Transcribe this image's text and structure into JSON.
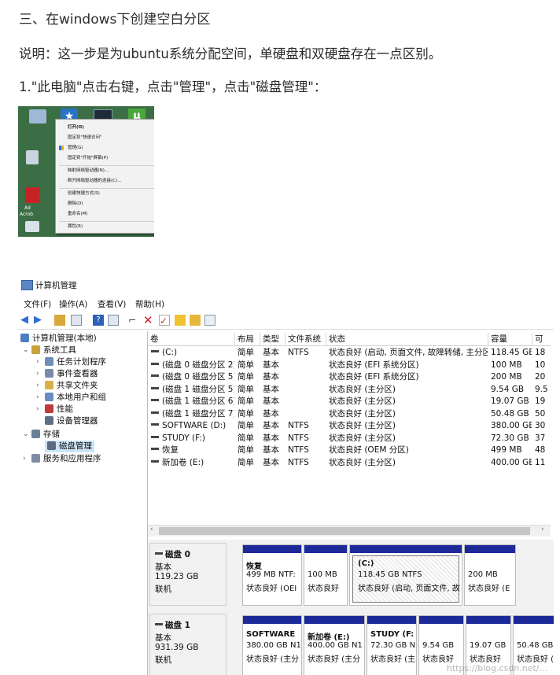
{
  "heading": "三、在windows下创建空白分区",
  "intro": "说明：这一步是为ubuntu系统分配空间，单硬盘和双硬盘存在一点区别。",
  "step1": "1.\"此电脑\"点击右键，点击\"管理\"，点击\"磁盘管理\"：",
  "context_menu": {
    "desktop_labels": [
      "Ad",
      "Acrob"
    ],
    "items": [
      {
        "label": "打开(O)",
        "bold": true
      },
      {
        "label": "固定到\"快速访问\""
      },
      {
        "label": "管理(G)"
      },
      {
        "label": "固定到\"开始\"屏幕(P)"
      },
      {
        "label": "映射网络驱动器(N)..."
      },
      {
        "label": "断开网络驱动器的连接(C)..."
      },
      {
        "label": "创建快捷方式(S)"
      },
      {
        "label": "删除(D)"
      },
      {
        "label": "重命名(M)"
      },
      {
        "label": "属性(R)"
      }
    ]
  },
  "window": {
    "title": "计算机管理",
    "menu": [
      "文件(F)",
      "操作(A)",
      "查看(V)",
      "帮助(H)"
    ],
    "tree": [
      {
        "label": "计算机管理(本地)",
        "icon": "computer-management-icon",
        "color": "#4a7fc0"
      },
      {
        "label": "系统工具",
        "icon": "tools-icon",
        "color": "#c9a23c"
      },
      {
        "label": "任务计划程序",
        "icon": "clock-icon",
        "color": "#6d8fb3"
      },
      {
        "label": "事件查看器",
        "icon": "event-viewer-icon",
        "color": "#7a8aa8"
      },
      {
        "label": "共享文件夹",
        "icon": "shared-folder-icon",
        "color": "#d8b048"
      },
      {
        "label": "本地用户和组",
        "icon": "users-icon",
        "color": "#6a8cc4"
      },
      {
        "label": "性能",
        "icon": "performance-icon",
        "color": "#c03a3a"
      },
      {
        "label": "设备管理器",
        "icon": "device-manager-icon",
        "color": "#5c6f86"
      },
      {
        "label": "存储",
        "icon": "storage-icon",
        "color": "#6a7f98"
      },
      {
        "label": "磁盘管理",
        "icon": "disk-management-icon",
        "color": "#5a6b80"
      },
      {
        "label": "服务和应用程序",
        "icon": "services-icon",
        "color": "#7c8ca4"
      }
    ],
    "columns": [
      "卷",
      "布局",
      "类型",
      "文件系统",
      "状态",
      "容量",
      "可"
    ],
    "volumes": [
      {
        "name": "(C:)",
        "layout": "简单",
        "type": "基本",
        "fs": "NTFS",
        "status": "状态良好 (启动, 页面文件, 故障转储, 主分区)",
        "capacity": "118.45 GB",
        "free": "18"
      },
      {
        "name": "(磁盘 0 磁盘分区 2)",
        "layout": "简单",
        "type": "基本",
        "fs": "",
        "status": "状态良好 (EFI 系统分区)",
        "capacity": "100 MB",
        "free": "10"
      },
      {
        "name": "(磁盘 0 磁盘分区 5)",
        "layout": "简单",
        "type": "基本",
        "fs": "",
        "status": "状态良好 (EFI 系统分区)",
        "capacity": "200 MB",
        "free": "20"
      },
      {
        "name": "(磁盘 1 磁盘分区 5)",
        "layout": "简单",
        "type": "基本",
        "fs": "",
        "status": "状态良好 (主分区)",
        "capacity": "9.54 GB",
        "free": "9.5"
      },
      {
        "name": "(磁盘 1 磁盘分区 6)",
        "layout": "简单",
        "type": "基本",
        "fs": "",
        "status": "状态良好 (主分区)",
        "capacity": "19.07 GB",
        "free": "19"
      },
      {
        "name": "(磁盘 1 磁盘分区 7)",
        "layout": "简单",
        "type": "基本",
        "fs": "",
        "status": "状态良好 (主分区)",
        "capacity": "50.48 GB",
        "free": "50"
      },
      {
        "name": "SOFTWARE (D:)",
        "layout": "简单",
        "type": "基本",
        "fs": "NTFS",
        "status": "状态良好 (主分区)",
        "capacity": "380.00 GB",
        "free": "30"
      },
      {
        "name": "STUDY (F:)",
        "layout": "简单",
        "type": "基本",
        "fs": "NTFS",
        "status": "状态良好 (主分区)",
        "capacity": "72.30 GB",
        "free": "37"
      },
      {
        "name": "恢复",
        "layout": "简单",
        "type": "基本",
        "fs": "NTFS",
        "status": "状态良好 (OEM 分区)",
        "capacity": "499 MB",
        "free": "48"
      },
      {
        "name": "新加卷 (E:)",
        "layout": "简单",
        "type": "基本",
        "fs": "NTFS",
        "status": "状态良好 (主分区)",
        "capacity": "400.00 GB",
        "free": "11"
      }
    ],
    "disks": [
      {
        "name": "磁盘 0",
        "kind": "基本",
        "size": "119.23 GB",
        "state": "联机",
        "partitions": [
          {
            "l1": "恢复",
            "l2": "499 MB NTF:",
            "l3": "状态良好 (OEI",
            "selected": false
          },
          {
            "l1": "",
            "l2": "100 MB",
            "l3": "状态良好",
            "selected": false
          },
          {
            "l1": "(C:)",
            "l2": "118.45 GB NTFS",
            "l3": "状态良好 (启动, 页面文件, 故",
            "selected": true
          },
          {
            "l1": "",
            "l2": "200 MB",
            "l3": "状态良好 (E",
            "selected": false
          }
        ]
      },
      {
        "name": "磁盘 1",
        "kind": "基本",
        "size": "931.39 GB",
        "state": "联机",
        "partitions": [
          {
            "l1": "SOFTWARE",
            "l2": "380.00 GB N1",
            "l3": "状态良好 (主分",
            "selected": false
          },
          {
            "l1": "新加卷 (E:)",
            "l2": "400.00 GB N1",
            "l3": "状态良好 (主分",
            "selected": false
          },
          {
            "l1": "STUDY (F:",
            "l2": "72.30 GB N",
            "l3": "状态良好 (主",
            "selected": false
          },
          {
            "l1": "",
            "l2": "9.54 GB",
            "l3": "状态良好",
            "selected": false
          },
          {
            "l1": "",
            "l2": "19.07 GB",
            "l3": "状态良好",
            "selected": false
          },
          {
            "l1": "",
            "l2": "50.48 GB",
            "l3": "状态良好 (主",
            "selected": false
          }
        ]
      }
    ],
    "watermark": "https://blog.csdn.net/..."
  }
}
